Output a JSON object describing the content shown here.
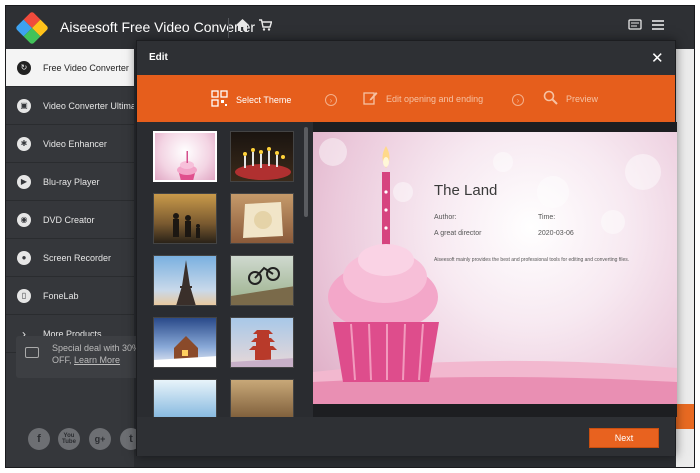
{
  "app": {
    "title": "Aiseesoft Free Video Converter"
  },
  "titlebar": {
    "home_icon": "home-icon",
    "cart_icon": "cart-icon",
    "feedback_icon": "feedback-icon"
  },
  "sidebar": {
    "items": [
      {
        "label": "Free Video Converter",
        "icon": "refresh-icon",
        "active": true
      },
      {
        "label": "Video Converter Ultimate",
        "icon": "film-icon",
        "active": false
      },
      {
        "label": "Video Enhancer",
        "icon": "palette-icon",
        "active": false
      },
      {
        "label": "Blu-ray Player",
        "icon": "play-icon",
        "active": false
      },
      {
        "label": "DVD Creator",
        "icon": "disc-icon",
        "active": false
      },
      {
        "label": "Screen Recorder",
        "icon": "camera-icon",
        "active": false
      },
      {
        "label": "FoneLab",
        "icon": "phone-icon",
        "active": false
      },
      {
        "label": "More Products",
        "icon": "chevron-right-icon",
        "active": false
      }
    ],
    "promo": {
      "text": "Special deal with 30% OFF,",
      "link": "Learn More"
    },
    "social": [
      "f",
      "You Tube",
      "g+",
      "t"
    ]
  },
  "dialog": {
    "title": "Edit",
    "steps": [
      {
        "label": "Select Theme",
        "icon": "qr-theme-icon",
        "active": true
      },
      {
        "label": "Edit opening and ending",
        "icon": "edit-icon",
        "active": false
      },
      {
        "label": "Preview",
        "icon": "search-icon",
        "active": false
      }
    ],
    "next_label": "Next",
    "preview": {
      "title": "The Land",
      "author_label": "Author:",
      "author_value": "A great director",
      "time_label": "Time:",
      "time_value": "2020-03-06",
      "description": "Aiseesoft mainly provides the best and professional tools for editing and converting files."
    }
  },
  "colors": {
    "accent": "#e65e1c",
    "sidebar": "#35373b",
    "window": "#2b2d31"
  }
}
